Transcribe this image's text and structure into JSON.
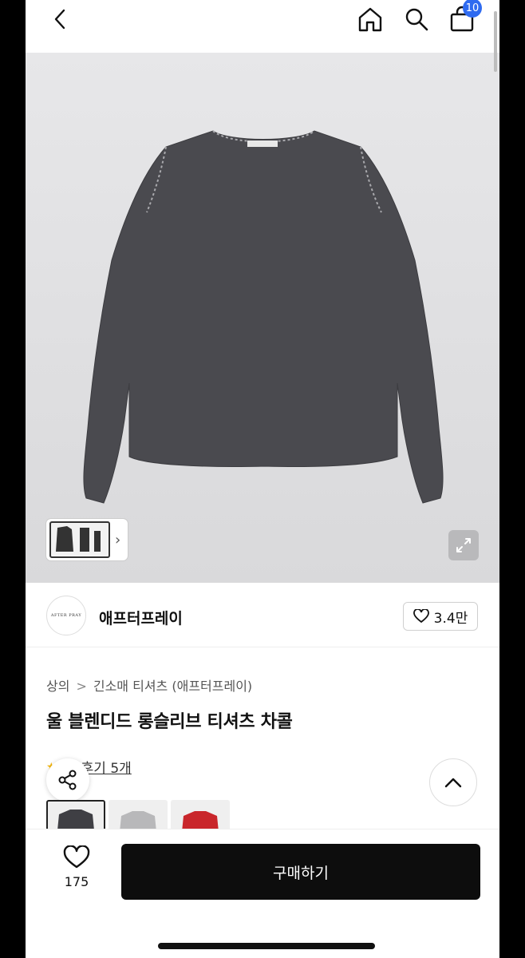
{
  "header": {
    "back_icon": "chevron-left-icon",
    "home_icon": "home-icon",
    "search_icon": "search-icon",
    "cart_icon": "shopping-bag-icon",
    "cart_badge": "10",
    "badge_color": "#2f6bf0"
  },
  "hero": {
    "garment_color": "#4a4a4f",
    "label_text": "AFTER PRAY"
  },
  "brand": {
    "logo_text": "AFTER PRAY",
    "name": "애프터프레이",
    "likes": "3.4만"
  },
  "breadcrumb": {
    "level1": "상의",
    "separator": ">",
    "level2": "긴소매 티셔츠 (애프터프레이)"
  },
  "product": {
    "title": "울 블렌디드 롱슬리브 티셔츠 차콜",
    "review_link": "후기 5개"
  },
  "colors": [
    "#3f3f44",
    "#b8b8ba",
    "#c9262b"
  ],
  "bottom": {
    "wish_count": "175",
    "buy_label": "구매하기"
  }
}
